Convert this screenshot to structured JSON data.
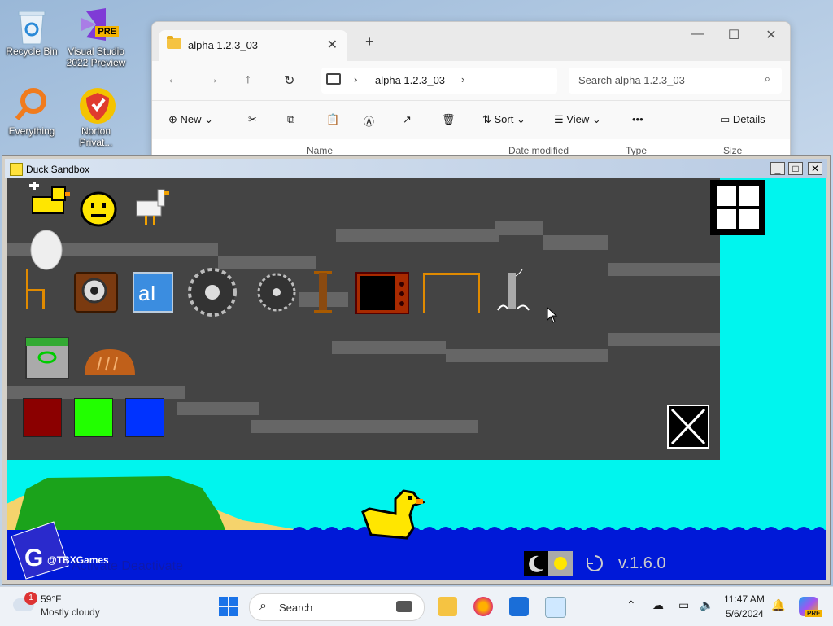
{
  "desktop": {
    "icons": [
      {
        "label": "Recycle Bin",
        "icon": "recycle-bin-icon"
      },
      {
        "label": "Visual Studio 2022 Preview",
        "badge": "PRE",
        "icon": "visual-studio-icon"
      },
      {
        "label": "Everything",
        "icon": "everything-search-icon"
      },
      {
        "label": "Norton Privat...",
        "icon": "norton-icon"
      }
    ]
  },
  "explorer": {
    "tab_title": "alpha 1.2.3_03",
    "new_tab": "+",
    "close_tab": "✕",
    "address": "alpha 1.2.3_03",
    "search_placeholder": "Search alpha 1.2.3_03",
    "commands": {
      "new": "New",
      "sort": "Sort",
      "view": "View",
      "more": "•••",
      "details": "Details"
    },
    "columns": [
      "Name",
      "Date modified",
      "Type",
      "Size"
    ]
  },
  "game": {
    "title": "Duck Sandbox",
    "version": "v.1.6.0",
    "watermark": "@TBXGames",
    "overlay_text": "Activate Deactivate",
    "swatches": [
      "#8b0000",
      "#22ff00",
      "#0033ff"
    ]
  },
  "taskbar": {
    "weather_temp": "59°F",
    "weather_desc": "Mostly cloudy",
    "weather_badge": "1",
    "search_label": "Search",
    "time": "11:47 AM",
    "date": "5/6/2024",
    "copilot_badge": "PRE"
  }
}
